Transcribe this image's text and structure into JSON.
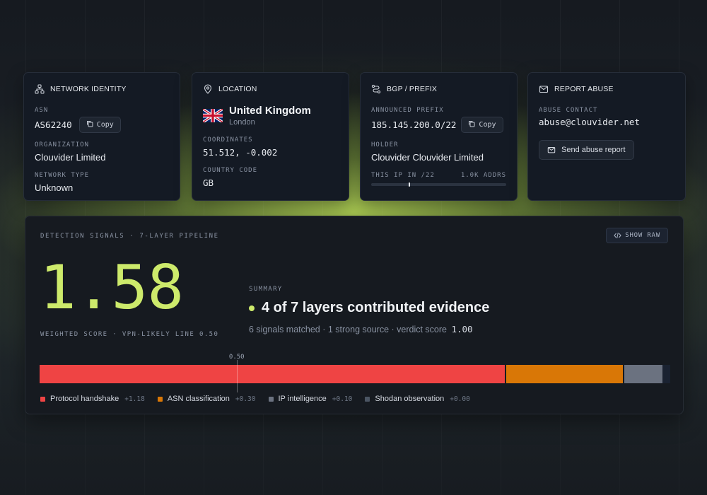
{
  "colors": {
    "accent": "#cdea6b",
    "protocol": "#ef4444",
    "asn": "#d97706",
    "ip": "#6b7280",
    "shodan": "#4b5563"
  },
  "network_identity": {
    "title": "NETWORK IDENTITY",
    "icon": "network-icon",
    "asn_label": "ASN",
    "asn_value": "AS62240",
    "copy_label": "Copy",
    "org_label": "ORGANIZATION",
    "org_value": "Clouvider Limited",
    "type_label": "NETWORK TYPE",
    "type_value": "Unknown"
  },
  "location": {
    "title": "LOCATION",
    "icon": "map-pin-icon",
    "country": "United Kingdom",
    "city": "London",
    "flag": "uk-flag",
    "coords_label": "COORDINATES",
    "coords_value": "51.512, -0.002",
    "code_label": "COUNTRY CODE",
    "code_value": "GB"
  },
  "bgp": {
    "title": "BGP / PREFIX",
    "icon": "route-icon",
    "prefix_label": "ANNOUNCED PREFIX",
    "prefix_value": "185.145.200.0/22",
    "copy_label": "Copy",
    "holder_label": "HOLDER",
    "holder_value": "Clouvider Clouvider Limited",
    "range_label": "THIS IP IN /22",
    "range_count": "1.0K ADDRS",
    "ip_position_fraction": 0.28
  },
  "abuse": {
    "title": "REPORT ABUSE",
    "icon": "mail-icon",
    "contact_label": "ABUSE CONTACT",
    "contact_value": "abuse@clouvider.net",
    "button_label": "Send abuse report"
  },
  "detection": {
    "title": "DETECTION SIGNALS · 7-LAYER PIPELINE",
    "show_raw_label": "SHOW RAW",
    "score": "1.58",
    "score_caption": "WEIGHTED SCORE · VPN-LIKELY LINE 0.50",
    "summary_label": "SUMMARY",
    "summary_headline": "4 of 7 layers contributed evidence",
    "summary_detail": "6 signals matched · 1 strong source · verdict score",
    "verdict_score": "1.00",
    "threshold_label": "0.50",
    "threshold_value": 0.5,
    "bar_max": 1.6,
    "segments": [
      {
        "name": "Protocol handshake",
        "value": 1.18,
        "delta": "+1.18",
        "color": "#ef4444"
      },
      {
        "name": "ASN classification",
        "value": 0.3,
        "delta": "+0.30",
        "color": "#d97706"
      },
      {
        "name": "IP intelligence",
        "value": 0.1,
        "delta": "+0.10",
        "color": "#6b7280"
      },
      {
        "name": "Shodan observation",
        "value": 0.0,
        "delta": "+0.00",
        "color": "#4b5563"
      }
    ]
  }
}
